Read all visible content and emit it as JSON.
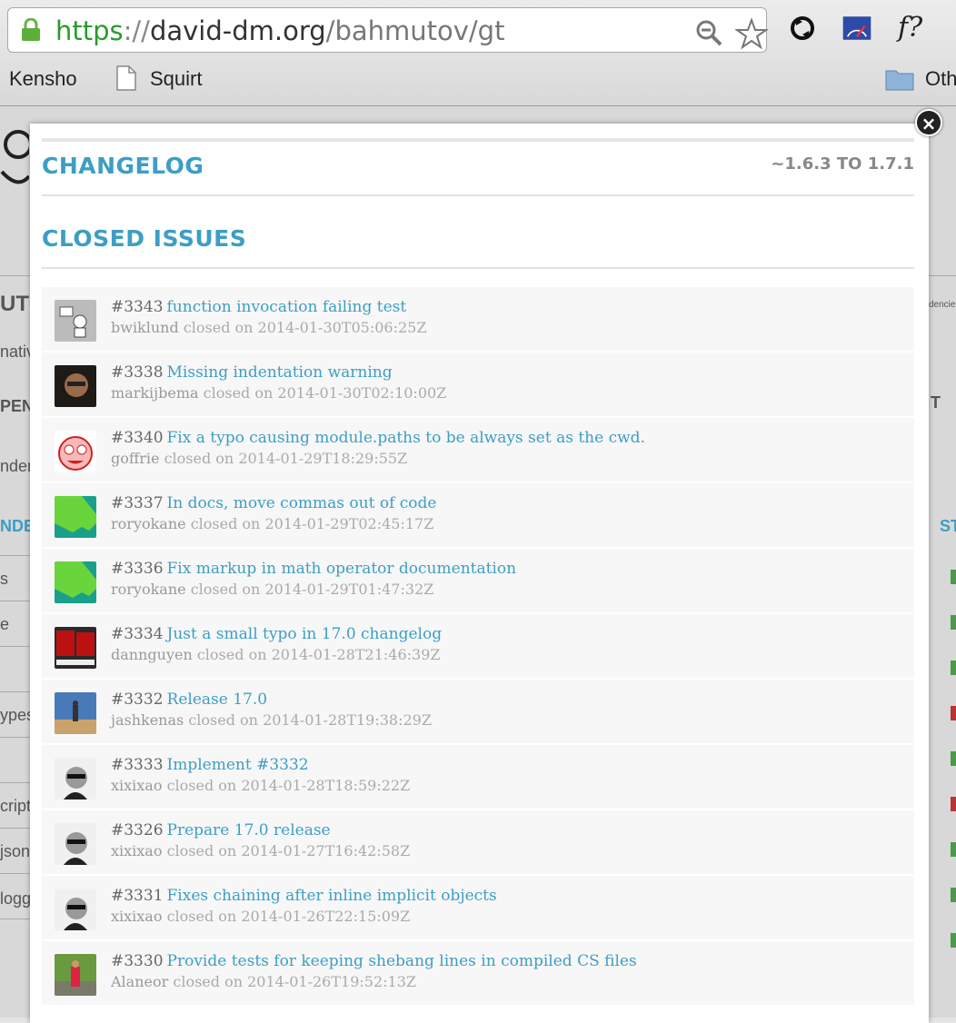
{
  "browser": {
    "url_scheme": "https",
    "url_sep": "://",
    "url_host": "david-dm.org",
    "url_path": "/bahmutov/gt",
    "ext3_label": "f?",
    "bookmarks": [
      "Kensho",
      "Squirt",
      "Oth"
    ]
  },
  "background": {
    "fragments": [
      "UT",
      "nativ",
      "PEN",
      "nden",
      "NDE",
      "s",
      "e",
      "ypes",
      "cript",
      "json",
      "logg",
      "dencie",
      "T",
      "ST"
    ]
  },
  "modal": {
    "title": "CHANGELOG",
    "range": "~1.6.3 TO 1.7.1",
    "subtitle": "CLOSED ISSUES",
    "close_label": "×"
  },
  "issues": [
    {
      "number": "#3343",
      "title": "function invocation failing test",
      "user": "bwiklund",
      "closed": "closed on 2014-01-30T05:06:25Z",
      "avatar": "robot-avatar"
    },
    {
      "number": "#3338",
      "title": "Missing indentation warning",
      "user": "markijbema",
      "closed": "closed on 2014-01-30T02:10:00Z",
      "avatar": "photo-avatar"
    },
    {
      "number": "#3340",
      "title": "Fix a typo causing module.paths to be always set as the cwd.",
      "user": "goffrie",
      "closed": "closed on 2014-01-29T18:29:55Z",
      "avatar": "cartoon-avatar"
    },
    {
      "number": "#3337",
      "title": "In docs, move commas out of code",
      "user": "roryokane",
      "closed": "closed on 2014-01-29T02:45:17Z",
      "avatar": "green-avatar"
    },
    {
      "number": "#3336",
      "title": "Fix markup in math operator documentation",
      "user": "roryokane",
      "closed": "closed on 2014-01-29T01:47:32Z",
      "avatar": "green-avatar"
    },
    {
      "number": "#3334",
      "title": "Just a small typo in 17.0 changelog",
      "user": "dannguyen",
      "closed": "closed on 2014-01-28T21:46:39Z",
      "avatar": "book-avatar"
    },
    {
      "number": "#3332",
      "title": "Release 17.0",
      "user": "jashkenas",
      "closed": "closed on 2014-01-28T19:38:29Z",
      "avatar": "sky-avatar"
    },
    {
      "number": "#3333",
      "title": "Implement #3332",
      "user": "xixixao",
      "closed": "closed on 2014-01-28T18:59:22Z",
      "avatar": "bw-avatar"
    },
    {
      "number": "#3326",
      "title": "Prepare 17.0 release",
      "user": "xixixao",
      "closed": "closed on 2014-01-27T16:42:58Z",
      "avatar": "bw-avatar"
    },
    {
      "number": "#3331",
      "title": "Fixes chaining after inline implicit objects",
      "user": "xixixao",
      "closed": "closed on 2014-01-26T22:15:09Z",
      "avatar": "bw-avatar"
    },
    {
      "number": "#3330",
      "title": "Provide tests for keeping shebang lines in compiled CS files",
      "user": "Alaneor",
      "closed": "closed on 2014-01-26T19:52:13Z",
      "avatar": "park-avatar"
    }
  ]
}
